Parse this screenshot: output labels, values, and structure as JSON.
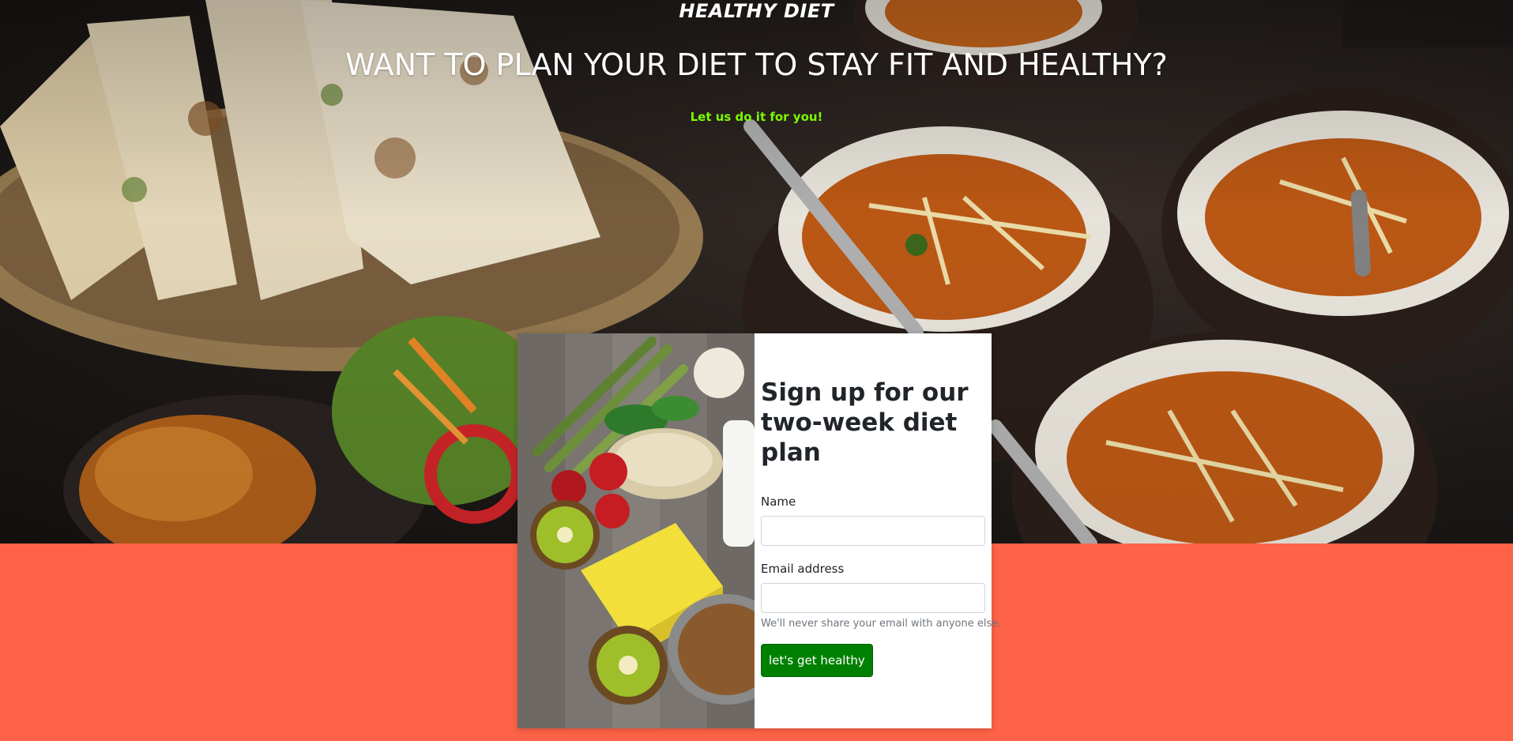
{
  "hero": {
    "brand": "HEALTHY DIET",
    "headline": "WANT TO PLAN YOUR DIET TO STAY FIT AND HEALTHY?",
    "tagline": "Let us do it for you!"
  },
  "signup": {
    "title": "Sign up for our two-week diet plan",
    "name_label": "Name",
    "name_value": "",
    "email_label": "Email address",
    "email_value": "",
    "email_help": "We'll never share your email with anyone else.",
    "submit_label": "let's get healthy"
  },
  "colors": {
    "page_background": "#ff6347",
    "tagline": "#7cfc00",
    "button": "#008000"
  }
}
